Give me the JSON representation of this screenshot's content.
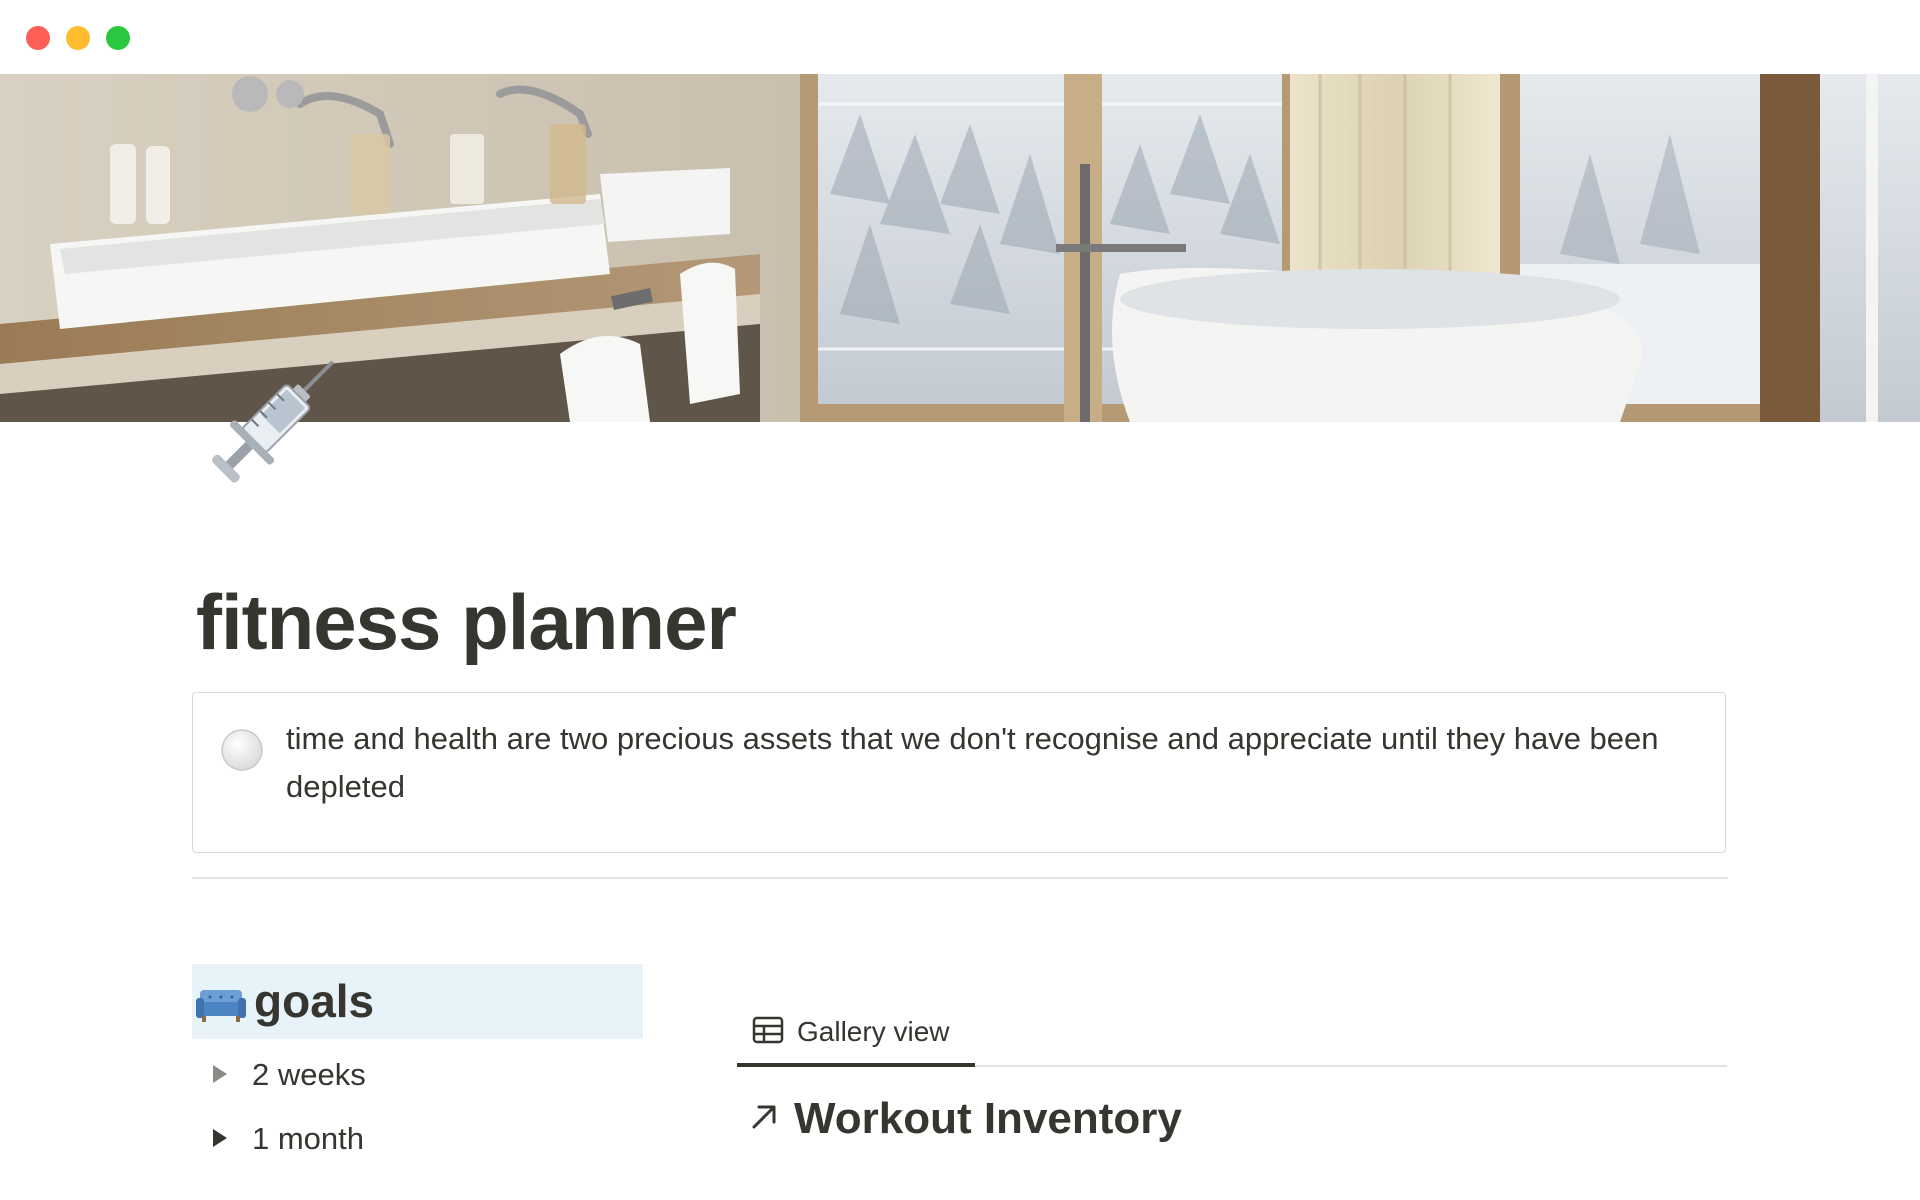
{
  "window": {
    "controls": [
      "close",
      "minimize",
      "maximize"
    ]
  },
  "cover": {
    "icon": "bathroom-cover-image"
  },
  "page": {
    "icon": "syringe-icon",
    "title": "fitness planner"
  },
  "callout": {
    "icon": "white-circle-icon",
    "text": "time and health are two precious assets that we don't recognise and appreciate until they have been depleted"
  },
  "goals": {
    "icon": "couch-icon",
    "heading": "goals",
    "items": [
      {
        "label": "2 weeks",
        "icon": "triangle-right-icon"
      },
      {
        "label": "1 month",
        "icon": "triangle-right-icon"
      }
    ]
  },
  "database": {
    "view_tab": {
      "icon": "table-icon",
      "label": "Gallery view"
    },
    "title": "Workout Inventory",
    "title_icon": "arrow-up-right-icon"
  },
  "colors": {
    "text": "#37352f",
    "heading_highlight": "#e7f3f8",
    "border": "#dcdad6",
    "close": "#fe5f57",
    "minimize": "#febc2e",
    "maximize": "#28c840"
  }
}
